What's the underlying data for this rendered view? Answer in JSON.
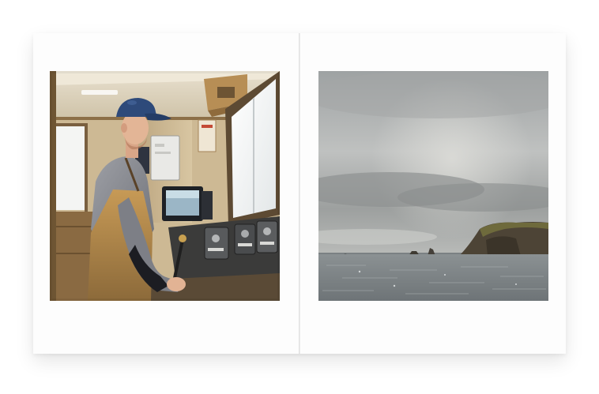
{
  "spread": {
    "left_page": {
      "photo": {
        "subject": "fisherman-in-wheelhouse",
        "icons": [
          "cap-icon",
          "radar-screen-icon",
          "control-console-icon"
        ]
      }
    },
    "right_page": {
      "photo": {
        "subject": "sea-cliff-under-overcast-sky",
        "icons": [
          "cliff-icon",
          "sea-stack-icon"
        ]
      }
    }
  },
  "colors": {
    "paper": "#fdfdfd",
    "cap_blue": "#2e4a7a",
    "jacket_gray": "#8d8f95",
    "overall_tan": "#b88a4a",
    "cabin_wood": "#c9b08a",
    "sky_gray": "#b9bcbd",
    "sea_gray": "#7e8588",
    "cliff_brown": "#4d4436"
  }
}
